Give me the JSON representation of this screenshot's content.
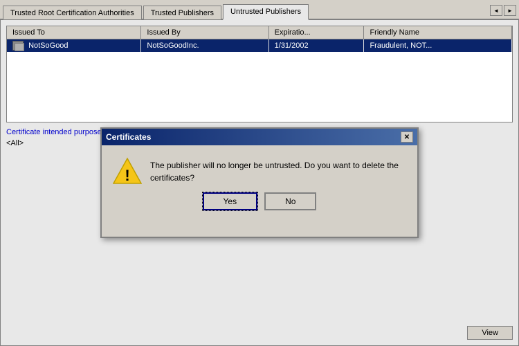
{
  "tabs": [
    {
      "id": "trusted-root",
      "label": "Trusted Root Certification Authorities",
      "active": false
    },
    {
      "id": "trusted-publishers",
      "label": "Trusted Publishers",
      "active": false
    },
    {
      "id": "untrusted-publishers",
      "label": "Untrusted Publishers",
      "active": true
    }
  ],
  "table": {
    "columns": [
      "Issued To",
      "Issued By",
      "Expiratio...",
      "Friendly Name"
    ],
    "rows": [
      {
        "issuedTo": "NotSoGood",
        "issuedBy": "NotSoGoodInc.",
        "expiration": "1/31/2002",
        "friendlyName": "Fraudulent, NOT..."
      }
    ]
  },
  "bottom": {
    "purposesLabel": "Certificate intended purposes",
    "purposesValue": "<All>"
  },
  "viewButton": "View",
  "modal": {
    "title": "Certificates",
    "message": "The publisher will no longer be untrusted.  Do you want to delete the certificates?",
    "yesLabel": "Yes",
    "noLabel": "No",
    "closeIcon": "✕"
  },
  "icons": {
    "leftNav": "◄",
    "rightNav": "►"
  }
}
